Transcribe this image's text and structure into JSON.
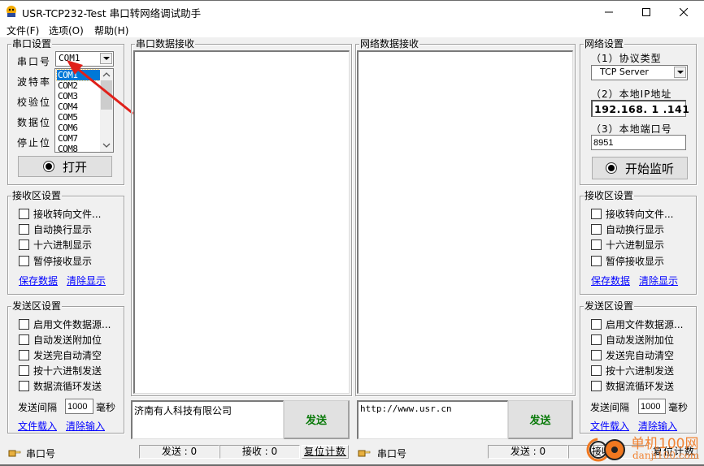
{
  "window": {
    "title": "USR-TCP232-Test 串口转网络调试助手",
    "minimize_icon": "minimize-icon",
    "maximize_icon": "maximize-icon",
    "close_icon": "close-icon"
  },
  "menu": {
    "items": [
      {
        "label": "文件(F)"
      },
      {
        "label": "选项(O)"
      },
      {
        "label": "帮助(H)"
      }
    ]
  },
  "serial_settings": {
    "title": "串口设置",
    "port_label": "串口号",
    "baud_label": "波特率",
    "parity_label": "校验位",
    "databits_label": "数据位",
    "stopbits_label": "停止位",
    "port_value": "COM1",
    "port_options": [
      "COM1",
      "COM2",
      "COM3",
      "COM4",
      "COM5",
      "COM6",
      "COM7",
      "COM8"
    ],
    "open_button": "打开"
  },
  "serial_receive_settings": {
    "title": "接收区设置",
    "options": [
      {
        "label": "接收转向文件...",
        "checked": false
      },
      {
        "label": "自动换行显示",
        "checked": false
      },
      {
        "label": "十六进制显示",
        "checked": false
      },
      {
        "label": "暂停接收显示",
        "checked": false
      }
    ],
    "save_link": "保存数据",
    "clear_link": "清除显示"
  },
  "serial_send_settings": {
    "title": "发送区设置",
    "options": [
      {
        "label": "启用文件数据源...",
        "checked": false
      },
      {
        "label": "自动发送附加位",
        "checked": false
      },
      {
        "label": "发送完自动清空",
        "checked": false
      },
      {
        "label": "按十六进制发送",
        "checked": false
      },
      {
        "label": "数据流循环发送",
        "checked": false
      }
    ],
    "interval_label": "发送间隔",
    "interval_value": "1000",
    "interval_unit": "毫秒",
    "load_file_link": "文件载入",
    "clear_input_link": "清除输入"
  },
  "serial_receive": {
    "title": "串口数据接收",
    "content": ""
  },
  "serial_send": {
    "input_value": "济南有人科技有限公司",
    "send_button": "发送"
  },
  "net_receive": {
    "title": "网络数据接收",
    "content": ""
  },
  "net_send": {
    "input_value": "http://www.usr.cn",
    "send_button": "发送"
  },
  "net_settings": {
    "title": "网络设置",
    "protocol_label": "（1）协议类型",
    "protocol_value": "TCP Server",
    "ip_label": "（2）本地IP地址",
    "ip_value": "192.168. 1 .141",
    "port_label": "（3）本地端口号",
    "port_value": "8951",
    "listen_button": "开始监听"
  },
  "net_receive_settings": {
    "title": "接收区设置",
    "options": [
      {
        "label": "接收转向文件...",
        "checked": false
      },
      {
        "label": "自动换行显示",
        "checked": false
      },
      {
        "label": "十六进制显示",
        "checked": false
      },
      {
        "label": "暂停接收显示",
        "checked": false
      }
    ],
    "save_link": "保存数据",
    "clear_link": "清除显示"
  },
  "net_send_settings": {
    "title": "发送区设置",
    "options": [
      {
        "label": "启用文件数据源...",
        "checked": false
      },
      {
        "label": "自动发送附加位",
        "checked": false
      },
      {
        "label": "发送完自动清空",
        "checked": false
      },
      {
        "label": "按十六进制发送",
        "checked": false
      },
      {
        "label": "数据流循环发送",
        "checked": false
      }
    ],
    "interval_label": "发送间隔",
    "interval_value": "1000",
    "interval_unit": "毫秒",
    "load_file_link": "文件载入",
    "clear_input_link": "清除输入"
  },
  "status_left": {
    "port_label": "串口号",
    "sent": "发送 : 0",
    "received": "接收 : 0",
    "reset": "复位计数"
  },
  "status_right": {
    "port_label": "串口号",
    "sent": "发送 : 0",
    "received": "接收",
    "reset": "复位计数"
  },
  "watermark": {
    "text": "单机100网",
    "subtext": "danji100.com"
  },
  "colors": {
    "accent": "#0078d7",
    "send_text": "#0a7a0a",
    "link": "#0000ff",
    "arrow": "#e0201a",
    "watermark": "#f07820"
  }
}
